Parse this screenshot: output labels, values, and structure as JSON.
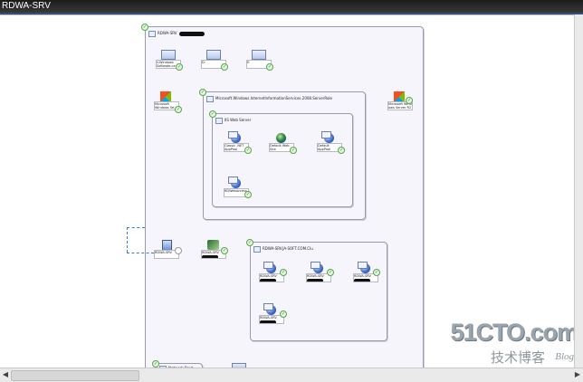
{
  "window": {
    "title": "RDWA-SRV"
  },
  "groups": {
    "outer": {
      "title": "RDWA-SRV"
    },
    "iis": {
      "title": "Microsoft.Windows.InternetInformationServices.2008.ServerRole"
    },
    "websites": {
      "title": "IIS Web Server"
    },
    "sql": {
      "title": "RDWA-SRV.JA-SOFT.COM.Clu"
    }
  },
  "nodes": {
    "top1": "V.Windows Softwate.ce",
    "top2": "D:",
    "top3": "E:",
    "win_os": "Microsoft Windows Se...",
    "win_net": "Microsoft Wind ows Server R2",
    "classic_pool": "Classic .NET AppPool",
    "default_site": "Default Web Site",
    "default_pool": "Default AppPool",
    "rdweb": "RDWebAccess",
    "rdwa_srv": "RDWA-SRV",
    "rdwa_svc": "RDWA-SRV",
    "sql1": "RDWA-SRV",
    "sql2": "RDWA-SRV",
    "sql3": "RDWA-SRV",
    "sql4": "RDWA-SRV",
    "bottom_item": "Network Rout..."
  },
  "watermark": {
    "site": "51CTO.com",
    "cn": "技术博客",
    "blog": "Blog"
  },
  "scroll": {
    "left": "◀",
    "right": "▶"
  }
}
